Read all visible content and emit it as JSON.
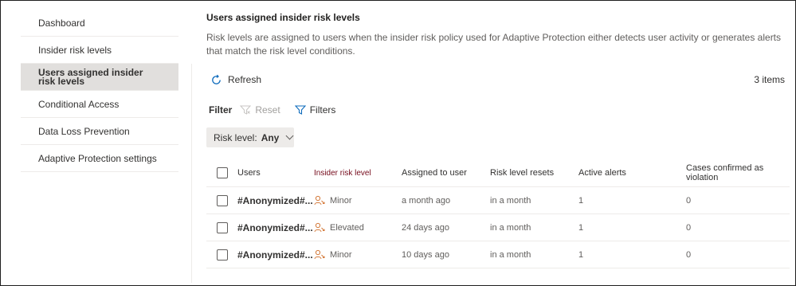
{
  "sidebar": {
    "items": [
      {
        "label": "Dashboard"
      },
      {
        "label": "Insider risk levels"
      },
      {
        "label": "Users assigned insider risk levels"
      },
      {
        "label": "Conditional Access"
      },
      {
        "label": "Data Loss Prevention"
      },
      {
        "label": "Adaptive Protection settings"
      }
    ],
    "active_index": 2
  },
  "main": {
    "title": "Users assigned insider risk levels",
    "description": "Risk levels are assigned to users when the insider risk policy used for Adaptive Protection either detects user activity or generates alerts that match the risk level conditions."
  },
  "toolbar": {
    "refresh_label": "Refresh",
    "items_count": "3 items"
  },
  "filter": {
    "label": "Filter",
    "reset_label": "Reset",
    "filters_label": "Filters",
    "risk_level_label": "Risk level:",
    "risk_level_value": "Any"
  },
  "table": {
    "columns": [
      "Users",
      "Insider risk level",
      "Assigned to user",
      "Risk level resets",
      "Active alerts",
      "Cases confirmed as violation"
    ],
    "rows": [
      {
        "user": "#Anonymized#...",
        "risk": "Minor",
        "assigned": "a month ago",
        "resets": "in a month",
        "alerts": "1",
        "cases": "0"
      },
      {
        "user": "#Anonymized#...",
        "risk": "Elevated",
        "assigned": "24 days ago",
        "resets": "in a month",
        "alerts": "1",
        "cases": "0"
      },
      {
        "user": "#Anonymized#...",
        "risk": "Minor",
        "assigned": "10 days ago",
        "resets": "in a month",
        "alerts": "1",
        "cases": "0"
      }
    ]
  },
  "colors": {
    "accent": "#0f6cbd",
    "risk_icon": "#d47a3b",
    "risk_header": "#750b1c"
  }
}
